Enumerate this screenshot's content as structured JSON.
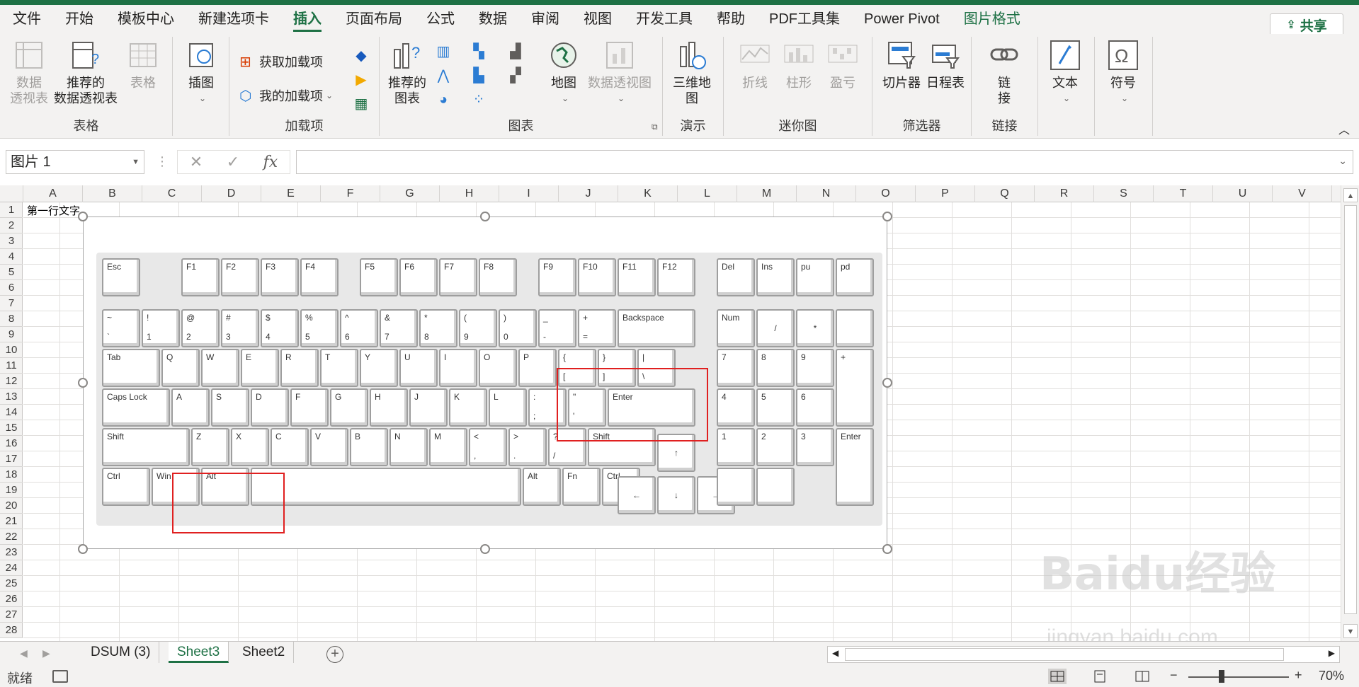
{
  "menu": {
    "tabs": [
      "文件",
      "开始",
      "模板中心",
      "新建选项卡",
      "插入",
      "页面布局",
      "公式",
      "数据",
      "审阅",
      "视图",
      "开发工具",
      "帮助",
      "PDF工具集",
      "Power Pivot",
      "图片格式"
    ],
    "active": "插入",
    "share": "共享"
  },
  "ribbon": {
    "groups": {
      "tables": "表格",
      "addins": "加载项",
      "charts": "图表",
      "tours": "演示",
      "sparklines": "迷你图",
      "filters": "筛选器",
      "links": "链接"
    },
    "pivot": "数据\n透视表",
    "recpivot": "推荐的\n数据透视表",
    "table": "表格",
    "illus": "插图",
    "getaddin": "获取加载项",
    "myaddin": "我的加载项",
    "recchart": "推荐的\n图表",
    "map": "地图",
    "pivotchart": "数据透视图",
    "map3d": "三维地\n图",
    "line": "折线",
    "column": "柱形",
    "winloss": "盈亏",
    "slicer": "切片器",
    "timeline": "日程表",
    "link": "链\n接",
    "text": "文本",
    "symbol": "符号"
  },
  "formula": {
    "namebox": "图片 1",
    "fx": "fx",
    "value": ""
  },
  "columns": [
    "A",
    "B",
    "C",
    "D",
    "E",
    "F",
    "G",
    "H",
    "I",
    "J",
    "K",
    "L",
    "M",
    "N",
    "O",
    "P",
    "Q",
    "R",
    "S",
    "T",
    "U",
    "V"
  ],
  "rows": [
    "1",
    "2",
    "3",
    "4",
    "5",
    "6",
    "7",
    "8",
    "9",
    "10",
    "11",
    "12",
    "13",
    "14",
    "15",
    "16",
    "17",
    "18",
    "19",
    "20",
    "21",
    "22",
    "23",
    "24",
    "25",
    "26",
    "27",
    "28"
  ],
  "cell_a1": "第一行文字",
  "keyboard": {
    "row_fn": [
      "Esc",
      "F1",
      "F2",
      "F3",
      "F4",
      "F5",
      "F6",
      "F7",
      "F8",
      "F9",
      "F10",
      "F11",
      "F12",
      "Del",
      "Ins",
      "pu",
      "pd"
    ],
    "row_num": [
      [
        "~",
        "`"
      ],
      [
        "!",
        "1"
      ],
      [
        "@",
        "2"
      ],
      [
        "#",
        "3"
      ],
      [
        "$",
        "4"
      ],
      [
        "%",
        "5"
      ],
      [
        "^",
        "6"
      ],
      [
        "&",
        "7"
      ],
      [
        "*",
        "8"
      ],
      [
        "(",
        "9"
      ],
      [
        ")",
        "0"
      ],
      [
        "_",
        "-"
      ],
      [
        "+",
        "="
      ],
      [
        "Backspace",
        ""
      ]
    ],
    "row_tab": [
      "Tab",
      "Q",
      "W",
      "E",
      "R",
      "T",
      "Y",
      "U",
      "I",
      "O",
      "P",
      [
        "{",
        "["
      ],
      [
        "}",
        "]"
      ],
      [
        "|",
        "\\"
      ]
    ],
    "row_caps": [
      "Caps Lock",
      "A",
      "S",
      "D",
      "F",
      "G",
      "H",
      "J",
      "K",
      "L",
      [
        ":",
        ";"
      ],
      [
        "\"",
        "'"
      ],
      "Enter"
    ],
    "row_shift": [
      "Shift",
      "Z",
      "X",
      "C",
      "V",
      "B",
      "N",
      "M",
      [
        "<",
        ","
      ],
      [
        ">",
        "."
      ],
      [
        "?",
        "/"
      ],
      "Shift"
    ],
    "row_ctrl": [
      "Ctrl",
      "Win",
      "Alt",
      "",
      "Alt",
      "Fn",
      "Ctrl"
    ],
    "arrows": [
      "↑",
      "←",
      "↓",
      "→"
    ],
    "numpad": [
      "Num",
      "/",
      "*",
      "",
      "7",
      "8",
      "9",
      "+",
      "4",
      "5",
      "6",
      "1",
      "2",
      "3",
      "Enter",
      "",
      ""
    ]
  },
  "sheets": [
    "DSUM (3)",
    "Sheet3",
    "Sheet2"
  ],
  "active_sheet": "Sheet3",
  "status": {
    "ready": "就绪",
    "zoom": "70%",
    "minus": "−",
    "plus": "+"
  },
  "watermark": {
    "brand": "Baidu经验",
    "url": "jingyan.baidu.com"
  },
  "colors": {
    "accent": "#1e7145",
    "highlight": "#e02020"
  }
}
